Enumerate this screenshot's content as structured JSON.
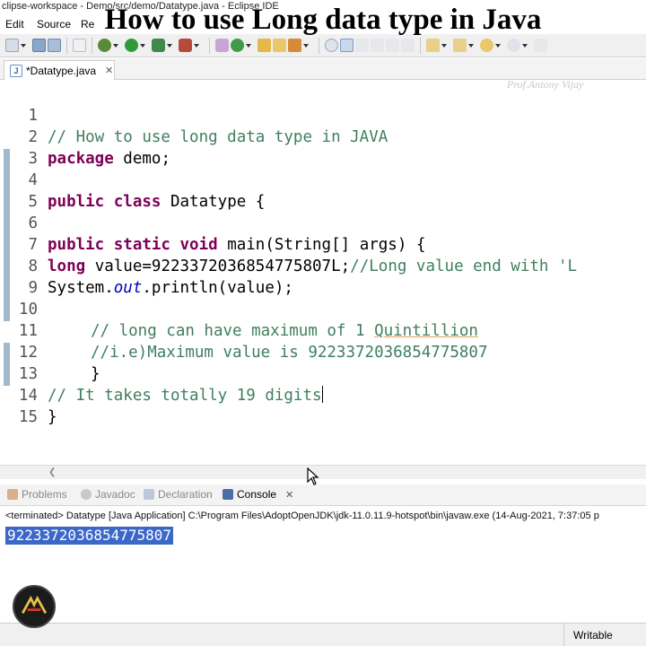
{
  "window": {
    "title": "clipse-workspace - Demo/src/demo/Datatype.java - Eclipse IDE"
  },
  "menu": {
    "items": [
      "Edit",
      "Source",
      "Re"
    ]
  },
  "overlay": {
    "title": "How to use Long data type in Java"
  },
  "editor": {
    "tab_label": "*Datatype.java",
    "watermark": "Prof.Antony Vijay",
    "lines": [
      {
        "n": "1",
        "text": "// How to use long data type in JAVA"
      },
      {
        "n": "2",
        "kw": "package",
        "text": " demo;"
      },
      {
        "n": "3",
        "text": ""
      },
      {
        "n": "4",
        "kw": "public class",
        "text": " Datatype {"
      },
      {
        "n": "5",
        "text": ""
      },
      {
        "n": "6",
        "kw": "public static void",
        "text": " main(String[] args) {"
      },
      {
        "n": "7",
        "kw": "long",
        "text": " value=9223372036854775807L;",
        "comment": "//Long value end with 'L"
      },
      {
        "n": "8",
        "pre": "System.",
        "static": "out",
        "text": ".println(value);"
      },
      {
        "n": "9",
        "text": ""
      },
      {
        "n": "10",
        "text": "// long can have maximum of 1 ",
        "under": "Quintillion"
      },
      {
        "n": "11",
        "text": "//i.e)Maximum value is 9223372036854775807"
      },
      {
        "n": "12",
        "text": "}"
      },
      {
        "n": "13",
        "text": "// It takes totally 19 digits"
      },
      {
        "n": "14",
        "text": "}"
      },
      {
        "n": "15",
        "text": ""
      }
    ]
  },
  "views": {
    "tabs": [
      "Problems",
      "Javadoc",
      "Declaration",
      "Console"
    ],
    "active": "Console"
  },
  "console": {
    "header": "<terminated> Datatype [Java Application] C:\\Program Files\\AdoptOpenJDK\\jdk-11.0.11.9-hotspot\\bin\\javaw.exe  (14-Aug-2021, 7:37:05 p",
    "output": "9223372036854775807"
  },
  "status": {
    "writable": "Writable"
  },
  "colors": {
    "keyword": "#7f0055",
    "comment": "#3f7f5f",
    "static_field": "#0000c0",
    "selection": "#3a67c8"
  },
  "icons": [
    "save-icon",
    "run-icon",
    "debug-icon",
    "new-java-class-icon",
    "search-icon",
    "close-icon",
    "logo-icon"
  ]
}
